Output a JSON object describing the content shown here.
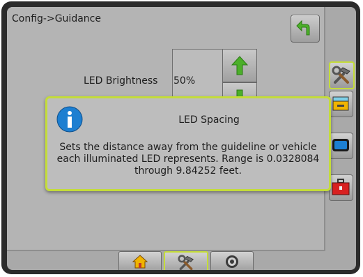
{
  "header": {
    "breadcrumb": "Config->Guidance"
  },
  "setting": {
    "label": "LED Brightness",
    "value": "50%"
  },
  "popup": {
    "title": "LED Spacing",
    "description": "Sets the distance away from the guideline or vehicle each illuminated LED represents. Range is 0.0328084 through 9.84252 feet."
  },
  "icons": {
    "back": "back-arrow-icon",
    "up": "green-up-arrow-icon",
    "down": "green-down-arrow-icon",
    "info": "info-icon",
    "side": [
      "tools-icon",
      "console-icon",
      "display-icon",
      "toolbox-icon"
    ],
    "bottom": [
      "home-icon",
      "tools-icon",
      "camera-icon"
    ]
  },
  "colors": {
    "highlight": "#c4dc3a",
    "info_blue": "#1d7fd1",
    "arrow_green": "#4caf2a"
  }
}
